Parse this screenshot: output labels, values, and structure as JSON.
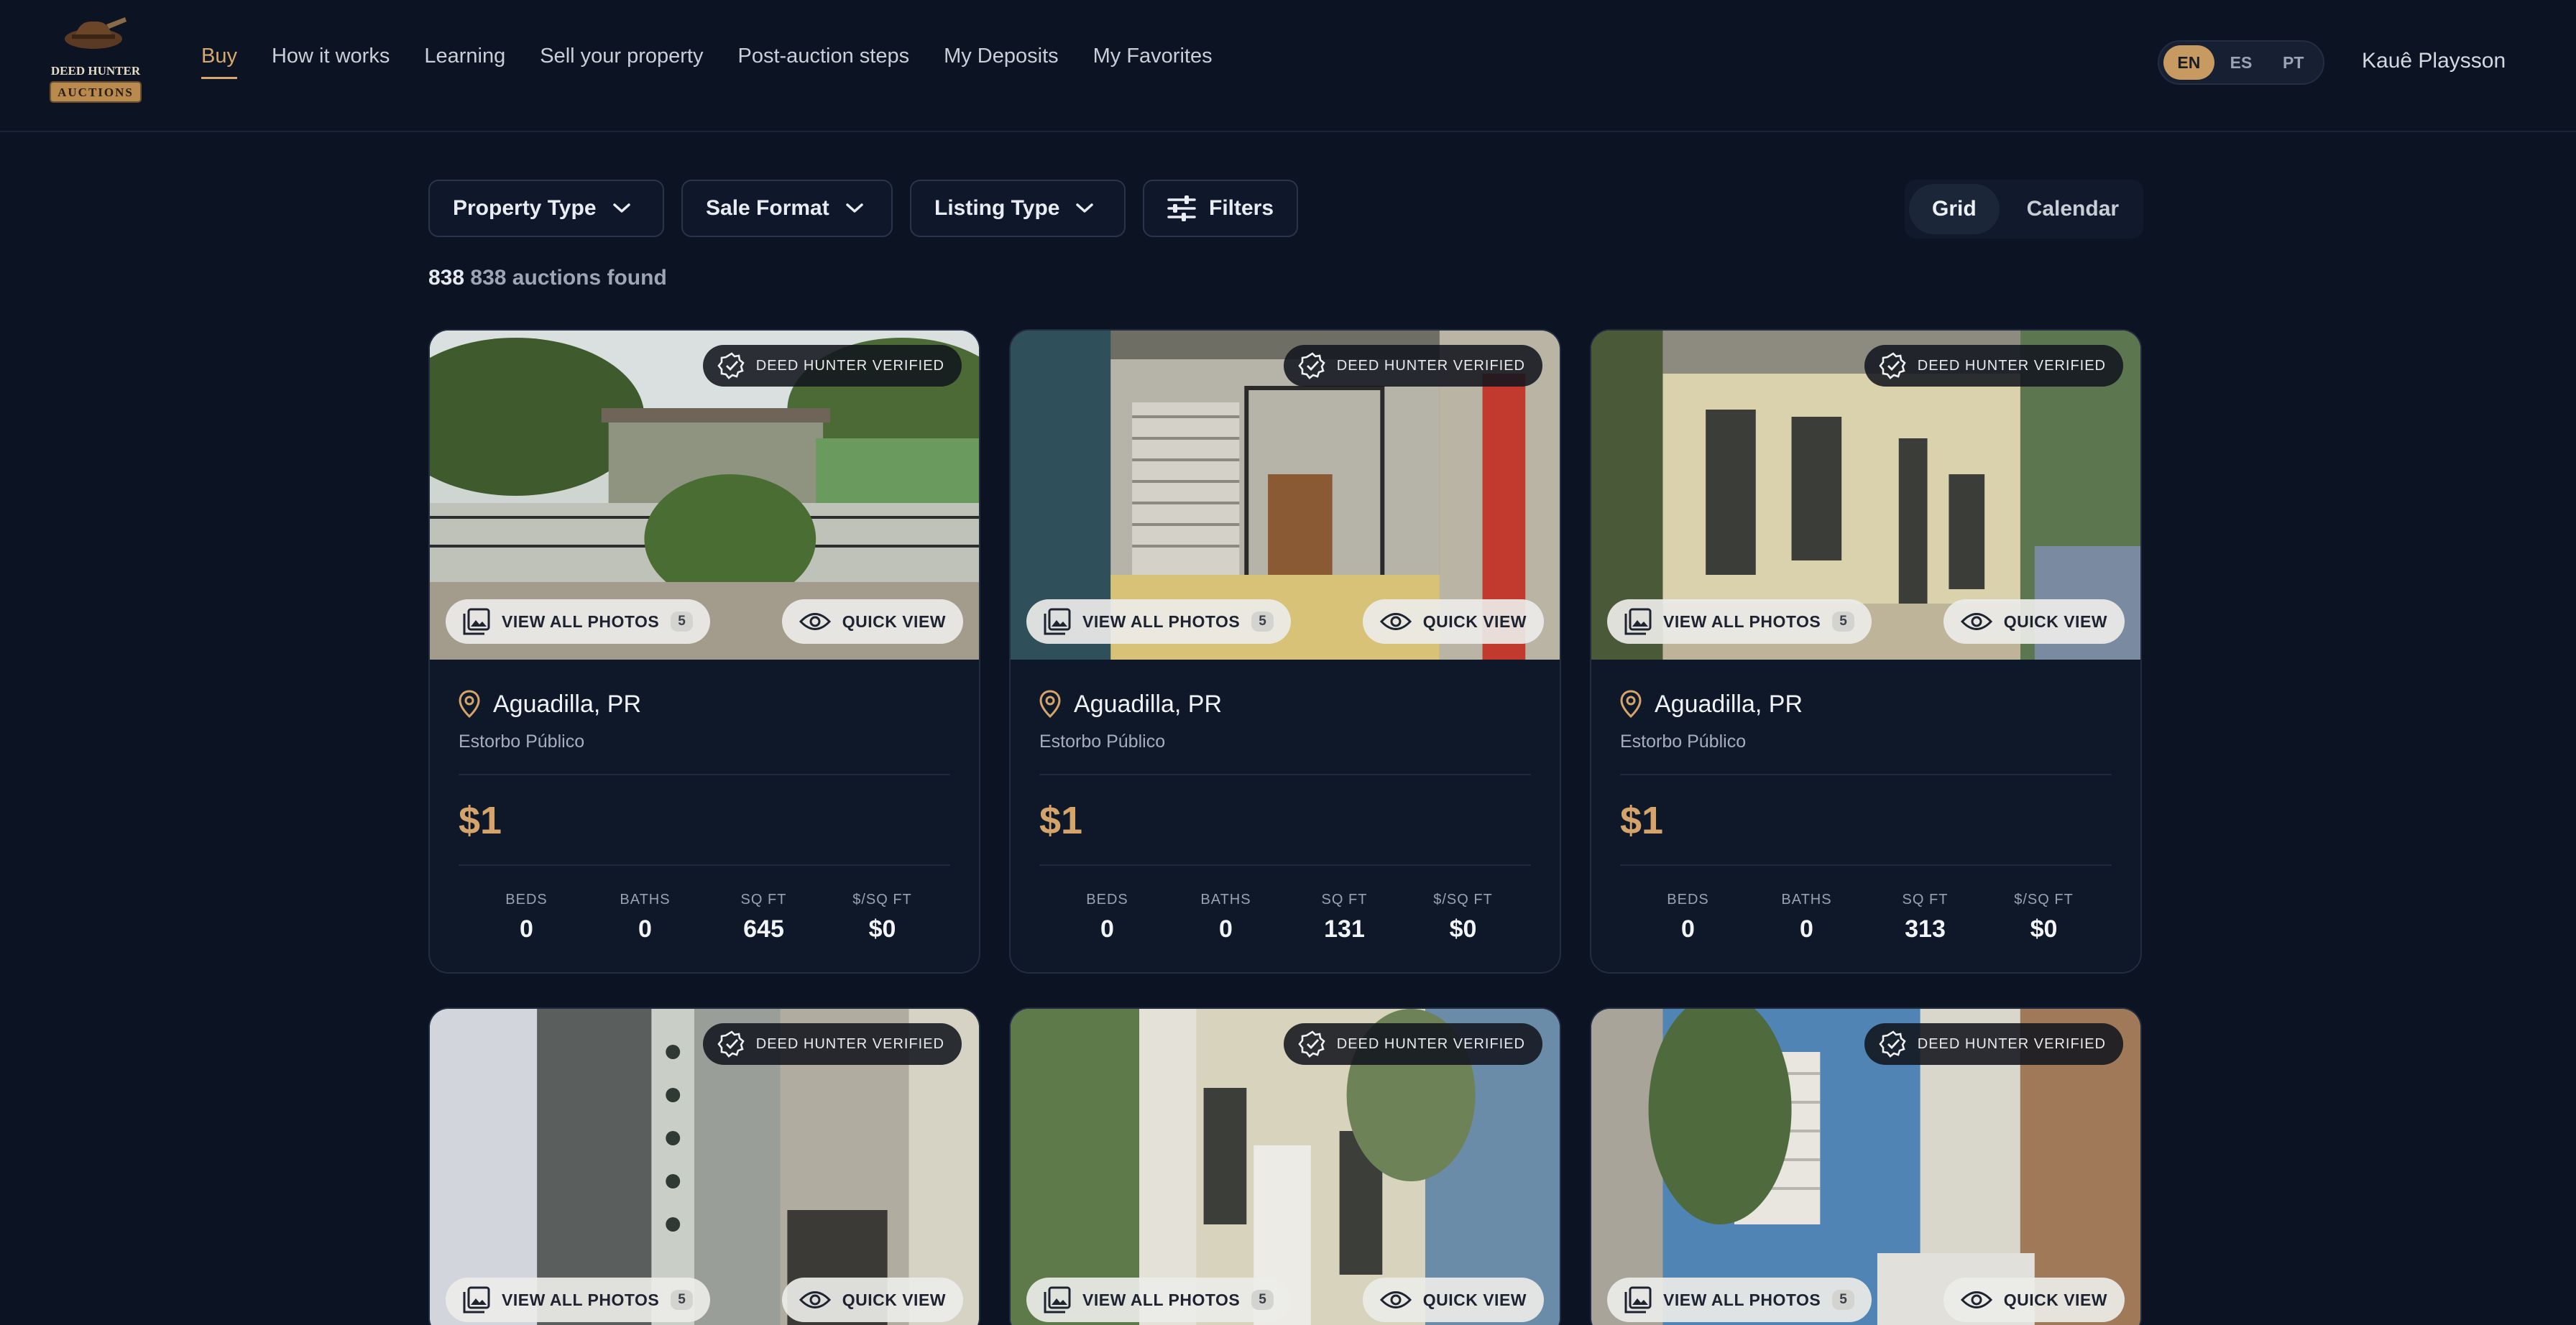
{
  "header": {
    "logo": {
      "line1": "DEED HUNTER",
      "line2": "AUCTIONS"
    },
    "nav": [
      {
        "label": "Buy",
        "active": true
      },
      {
        "label": "How it works"
      },
      {
        "label": "Learning"
      },
      {
        "label": "Sell your property"
      },
      {
        "label": "Post-auction steps"
      },
      {
        "label": "My Deposits"
      },
      {
        "label": "My Favorites"
      }
    ],
    "languages": [
      {
        "label": "EN",
        "active": true
      },
      {
        "label": "ES"
      },
      {
        "label": "PT"
      }
    ],
    "user_name": "Kauê Playsson"
  },
  "toolbar": {
    "property_type": "Property Type",
    "sale_format": "Sale Format",
    "listing_type": "Listing Type",
    "filters": "Filters",
    "view_grid": "Grid",
    "view_calendar": "Calendar",
    "results_num": "838",
    "results_text": "838 auctions found"
  },
  "colors": {
    "accent": "#d7a86e",
    "background": "#0c1424",
    "card": "#0f1829"
  },
  "cards": [
    {
      "verified": "DEED HUNTER VERIFIED",
      "view_photos": "VIEW ALL PHOTOS",
      "photo_count": "5",
      "quick_view": "QUICK VIEW",
      "city": "Aguadilla, PR",
      "sale_type": "Estorbo Público",
      "price": "$1",
      "beds_label": "BEDS",
      "beds": "0",
      "baths_label": "BATHS",
      "baths": "0",
      "sqft_label": "SQ FT",
      "sqft": "645",
      "ppsf_label": "$/SQ FT",
      "ppsf": "$0"
    },
    {
      "verified": "DEED HUNTER VERIFIED",
      "view_photos": "VIEW ALL PHOTOS",
      "photo_count": "5",
      "quick_view": "QUICK VIEW",
      "city": "Aguadilla, PR",
      "sale_type": "Estorbo Público",
      "price": "$1",
      "beds_label": "BEDS",
      "beds": "0",
      "baths_label": "BATHS",
      "baths": "0",
      "sqft_label": "SQ FT",
      "sqft": "131",
      "ppsf_label": "$/SQ FT",
      "ppsf": "$0"
    },
    {
      "verified": "DEED HUNTER VERIFIED",
      "view_photos": "VIEW ALL PHOTOS",
      "photo_count": "5",
      "quick_view": "QUICK VIEW",
      "city": "Aguadilla, PR",
      "sale_type": "Estorbo Público",
      "price": "$1",
      "beds_label": "BEDS",
      "beds": "0",
      "baths_label": "BATHS",
      "baths": "0",
      "sqft_label": "SQ FT",
      "sqft": "313",
      "ppsf_label": "$/SQ FT",
      "ppsf": "$0"
    },
    {
      "verified": "DEED HUNTER VERIFIED",
      "view_photos": "VIEW ALL PHOTOS",
      "photo_count": "5",
      "quick_view": "QUICK VIEW"
    },
    {
      "verified": "DEED HUNTER VERIFIED",
      "view_photos": "VIEW ALL PHOTOS",
      "photo_count": "5",
      "quick_view": "QUICK VIEW"
    },
    {
      "verified": "DEED HUNTER VERIFIED",
      "view_photos": "VIEW ALL PHOTOS",
      "photo_count": "5",
      "quick_view": "QUICK VIEW"
    }
  ]
}
